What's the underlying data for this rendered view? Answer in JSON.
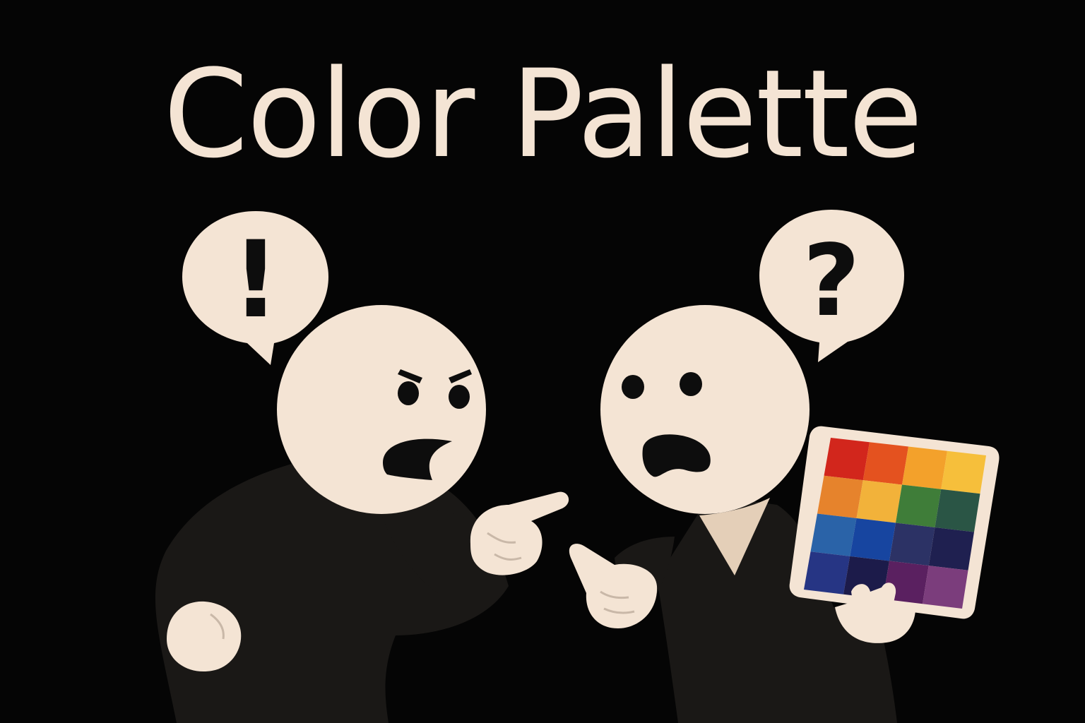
{
  "title": "Color Palette",
  "bubbles": {
    "left_symbol": "!",
    "right_symbol": "?"
  },
  "colors": {
    "background": "#050505",
    "title_text": "#f4e4d4",
    "skin": "#f4e4d4",
    "clothing": "#1a1816",
    "features": "#0d0d0d",
    "palette_frame": "#f4e4d4",
    "palette_swatches": [
      [
        "#d2261c",
        "#e4521f",
        "#f3a12b",
        "#f6bf3b"
      ],
      [
        "#e6832c",
        "#f2b23a",
        "#3f7d39",
        "#2a5545"
      ],
      [
        "#2a63a8",
        "#1745a0",
        "#2c3265",
        "#1f2050"
      ],
      [
        "#263584",
        "#1c1b4a",
        "#5a2060",
        "#7b3d7c"
      ]
    ]
  },
  "characters": [
    {
      "name": "angry-person",
      "expression": "angry",
      "gesture": "pointing"
    },
    {
      "name": "confused-person",
      "expression": "shocked",
      "gesture": "pointing, holding color palette"
    }
  ]
}
